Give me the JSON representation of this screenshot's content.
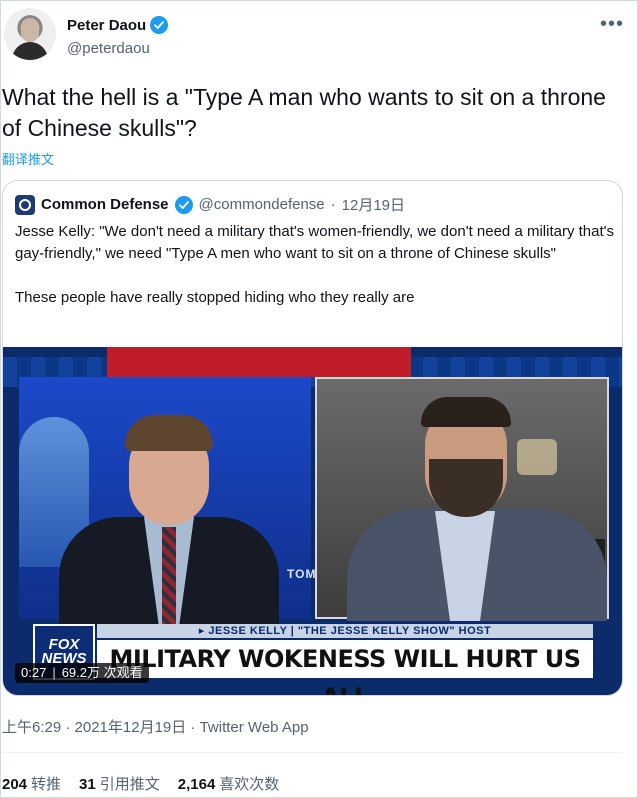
{
  "author": {
    "display_name": "Peter Daou",
    "handle": "@peterdaou",
    "verified": true
  },
  "tweet": {
    "text": "What the hell is a \"Type A man who wants to sit on a throne of Chinese skulls\"?",
    "translate_label": "翻译推文"
  },
  "quote": {
    "display_name": "Common Defense",
    "handle": "@commondefense",
    "separator": "·",
    "date": "12月19日",
    "verified": true,
    "paragraph1": "Jesse Kelly: \"We don't need a military that's women-friendly, we don't need a military that's gay-friendly,\" we need \"Type A men who want to sit on a throne of Chinese skulls\"",
    "paragraph2": "These people have really stopped hiding who they really are",
    "video": {
      "chyron_tag": "▸ JESSE KELLY | \"THE JESSE KELLY SHOW\" HOST",
      "chyron_headline": "MILITARY WOKENESS WILL HURT US ALL",
      "logo_text": "FOX NEWS",
      "background_text": "TOM",
      "duration": "0:27",
      "views": "69.2万 次观看"
    }
  },
  "meta": {
    "text": "上午6:29 · 2021年12月19日 · Twitter Web App"
  },
  "stats": {
    "retweets_count": "204",
    "retweets_label": "转推",
    "quotes_count": "31",
    "quotes_label": "引用推文",
    "likes_count": "2,164",
    "likes_label": "喜欢次数"
  },
  "colors": {
    "accent": "#1d9bf0",
    "text": "#0f1419",
    "muted": "#536471",
    "border": "#cfd9de"
  }
}
